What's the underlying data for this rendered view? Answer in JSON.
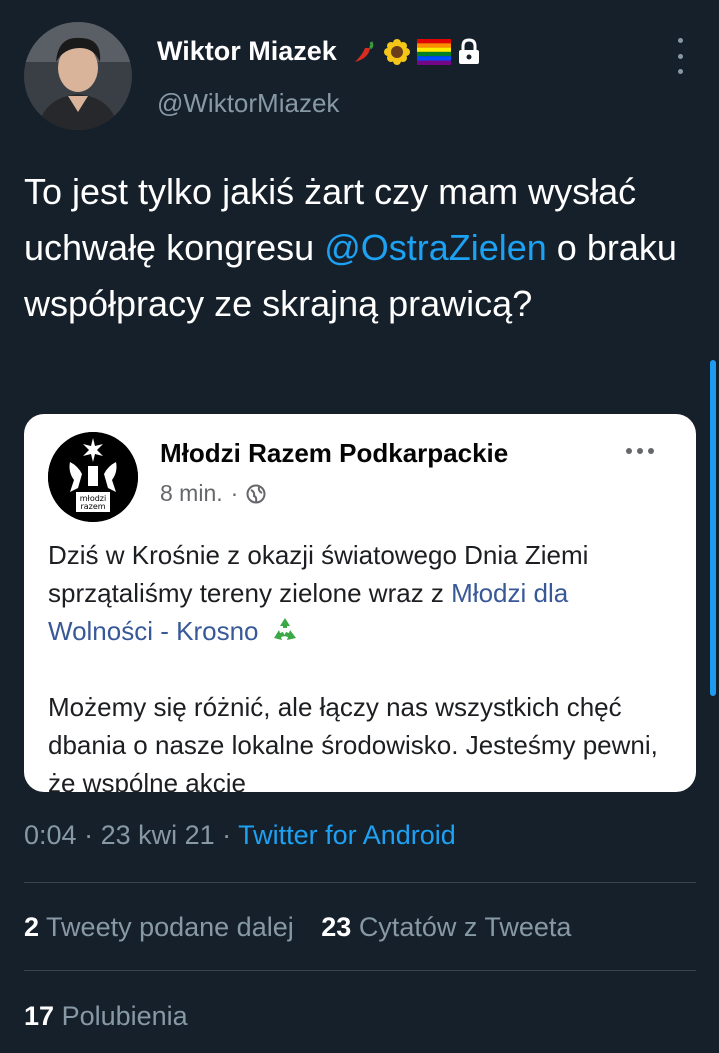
{
  "author": {
    "name": "Wiktor Miazek",
    "handle": "@WiktorMiazek",
    "name_emojis": [
      "hot-pepper",
      "sunflower",
      "rainbow-flag",
      "lock"
    ]
  },
  "tweet": {
    "text_before_mention": "To jest tylko jakiś żart czy mam wysłać uchwałę kongresu ",
    "mention": "@OstraZielen",
    "text_after_mention": " o braku współpracy ze skrajną prawicą?"
  },
  "embedded_post": {
    "page_name": "Młodzi Razem Podkarpackie",
    "avatar_text": "młodzi razem",
    "time": "8 min.",
    "separator": "·",
    "p1_text": "Dziś w Krośnie z okazji światowego Dnia Ziemi sprzątaliśmy tereny zielone wraz z ",
    "p1_link": "Młodzi dla Wolności - Krosno",
    "p2_text": "Możemy się różnić, ale łączy nas wszystkich chęć dbania o nasze lokalne środowisko. Jesteśmy pewni, że wspólne akcje"
  },
  "meta": {
    "time": "0:04",
    "sep1": " · ",
    "date": "23 kwi 21",
    "sep2": " · ",
    "source": "Twitter for Android"
  },
  "stats": {
    "retweets_count": "2",
    "retweets_label": "Tweety podane dalej",
    "quotes_count": "23",
    "quotes_label": "Cytatów z Tweeta",
    "likes_count": "17",
    "likes_label": "Polubienia"
  },
  "colors": {
    "background": "#15202b",
    "accent": "#1da1f2",
    "secondary_text": "#8899a6",
    "divider": "#38444d"
  }
}
